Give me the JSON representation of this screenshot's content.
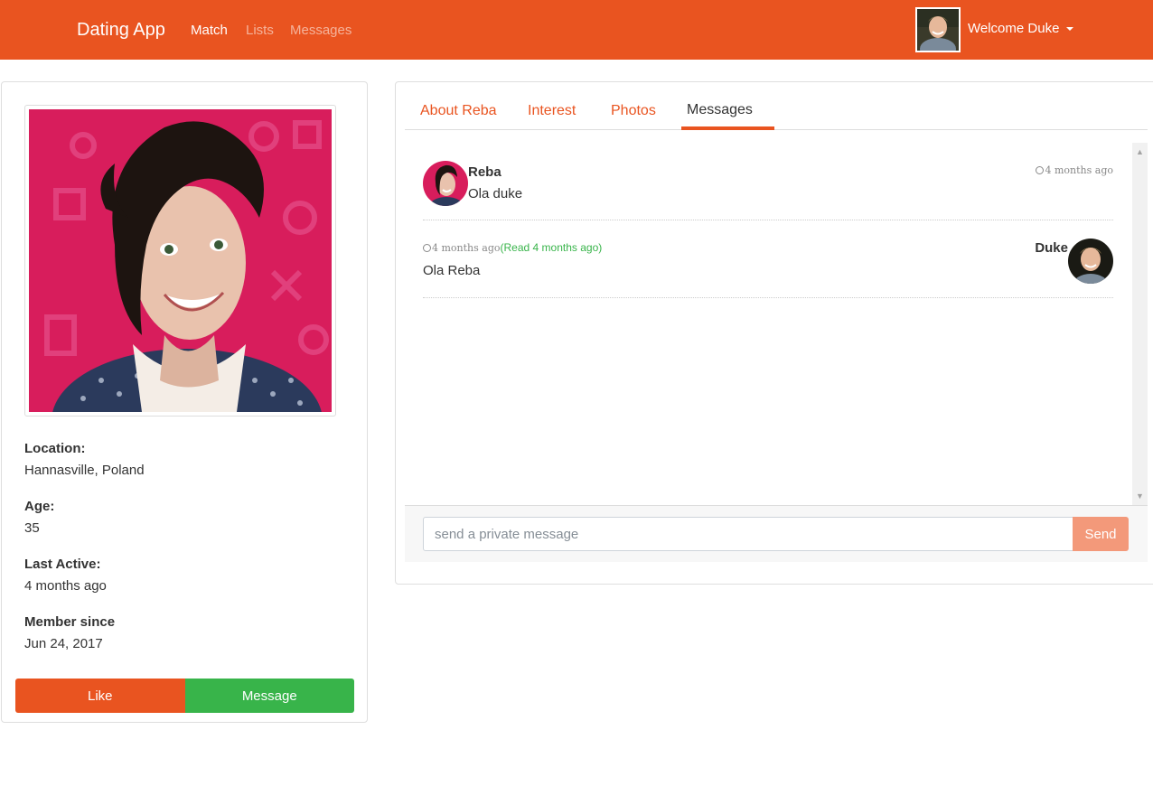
{
  "navbar": {
    "brand": "Dating App",
    "links": [
      {
        "label": "Match",
        "active": true
      },
      {
        "label": "Lists",
        "active": false
      },
      {
        "label": "Messages",
        "active": false
      }
    ],
    "welcome": "Welcome Duke",
    "color": "#E95420"
  },
  "profile": {
    "location_label": "Location:",
    "location": "Hannasville, Poland",
    "age_label": "Age:",
    "age": "35",
    "last_active_label": "Last Active:",
    "last_active": "4 months ago",
    "member_since_label": "Member since",
    "member_since": "Jun 24, 2017",
    "like_label": "Like",
    "message_label": "Message"
  },
  "tabs": [
    {
      "label": "About Reba",
      "active": false
    },
    {
      "label": "Interest",
      "active": false
    },
    {
      "label": "Photos",
      "active": false
    },
    {
      "label": "Messages",
      "active": true
    }
  ],
  "messages": [
    {
      "sender": "Reba",
      "text": "Ola duke",
      "time": "4 months ago",
      "direction": "incoming"
    },
    {
      "sender": "Duke",
      "text": "Ola Reba",
      "time": "4 months ago",
      "read_status": "(Read 4 months ago)",
      "direction": "outgoing"
    }
  ],
  "composer": {
    "placeholder": "send a private message",
    "send_label": "Send"
  },
  "colors": {
    "primary": "#E95420",
    "success": "#38B44A",
    "send_disabled": "#F3997A"
  }
}
